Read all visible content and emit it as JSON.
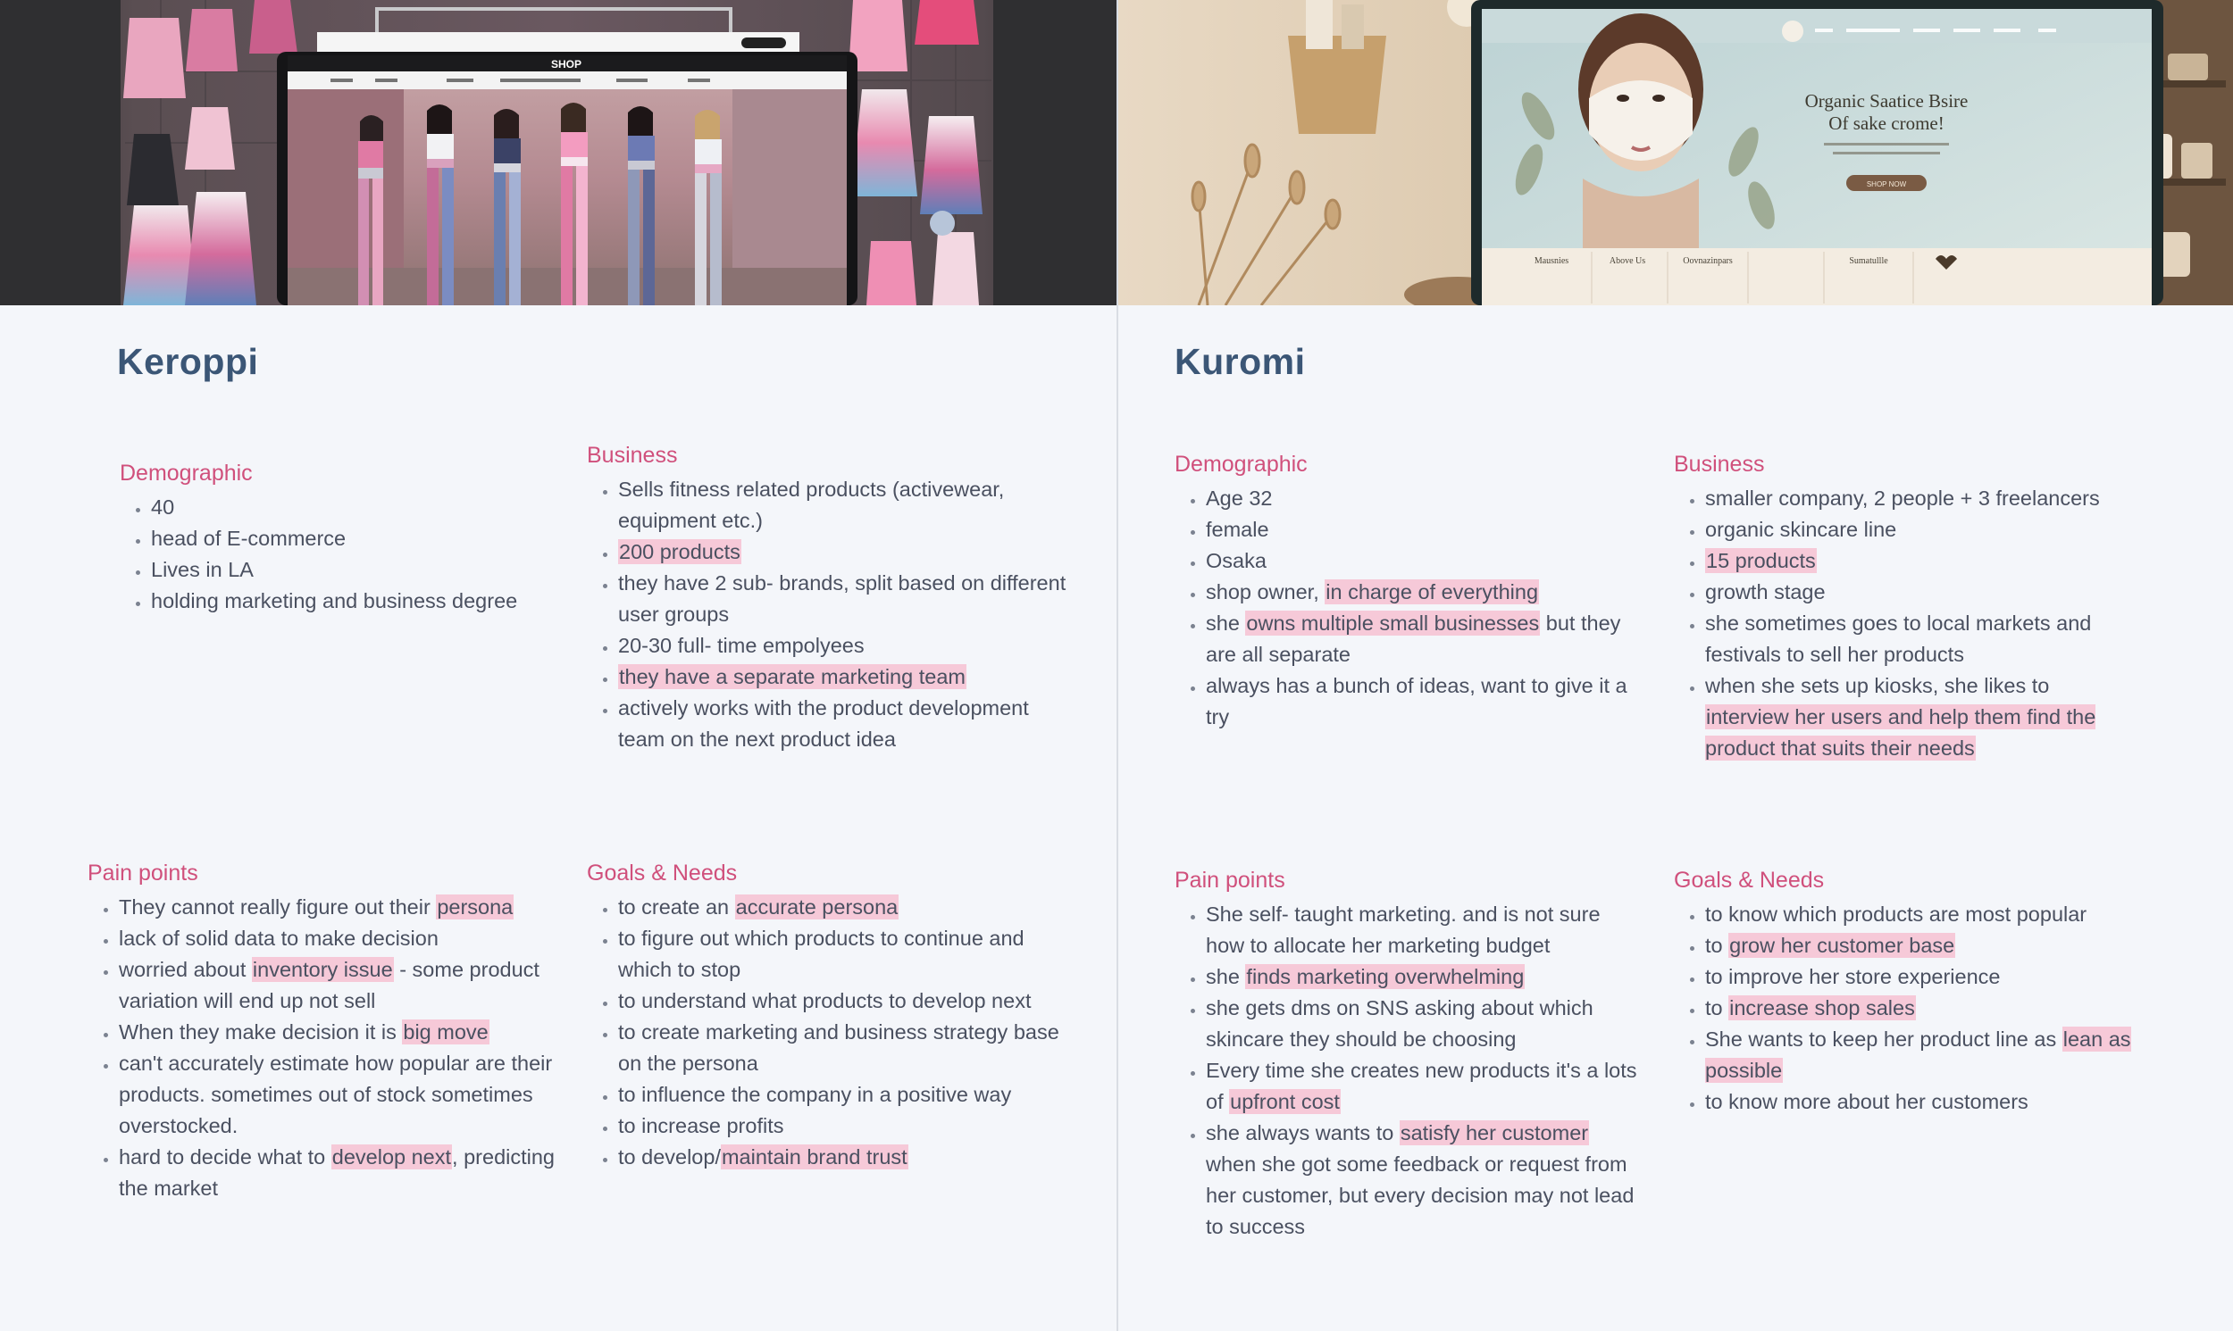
{
  "personas": [
    {
      "name": "Keroppi",
      "demographic": {
        "title": "Demographic",
        "items": [
          [
            {
              "t": "40"
            }
          ],
          [
            {
              "t": "head of E-commerce"
            }
          ],
          [
            {
              "t": "Lives in LA"
            }
          ],
          [
            {
              "t": "holding marketing and business degree"
            }
          ]
        ]
      },
      "business": {
        "title": "Business",
        "items": [
          [
            {
              "t": "Sells fitness related products (activewear, equipment etc.)"
            }
          ],
          [
            {
              "t": "200 products",
              "h": true
            }
          ],
          [
            {
              "t": "they have 2 sub- brands, split based on different user groups"
            }
          ],
          [
            {
              "t": "20-30 full- time empolyees"
            }
          ],
          [
            {
              "t": "they have a separate marketing team",
              "h": true
            }
          ],
          [
            {
              "t": "actively works with the product development team on the next product idea"
            }
          ]
        ]
      },
      "pain_points": {
        "title": "Pain points",
        "items": [
          [
            {
              "t": "They cannot really figure out their "
            },
            {
              "t": "persona",
              "h": true
            }
          ],
          [
            {
              "t": "lack of solid data to make decision"
            }
          ],
          [
            {
              "t": "worried about "
            },
            {
              "t": "inventory issue",
              "h": true
            },
            {
              "t": " - some product variation will end up not sell"
            }
          ],
          [
            {
              "t": "When they make decision it is "
            },
            {
              "t": "big move",
              "h": true
            }
          ],
          [
            {
              "t": "can't accurately estimate how popular are their products. sometimes out of stock sometimes overstocked."
            }
          ],
          [
            {
              "t": "hard to decide what to "
            },
            {
              "t": "develop next",
              "h": true
            },
            {
              "t": ", predicting the market"
            }
          ]
        ]
      },
      "goals": {
        "title": "Goals & Needs",
        "items": [
          [
            {
              "t": "to create an "
            },
            {
              "t": "accurate persona ",
              "h": true
            }
          ],
          [
            {
              "t": "to figure out which products to continue and which to stop"
            }
          ],
          [
            {
              "t": "to understand what products to develop next"
            }
          ],
          [
            {
              "t": "to create marketing and business strategy base on the persona"
            }
          ],
          [
            {
              "t": "to influence the company in a positive way"
            }
          ],
          [
            {
              "t": "to increase profits"
            }
          ],
          [
            {
              "t": "to develop/"
            },
            {
              "t": "maintain brand trust",
              "h": true
            }
          ]
        ]
      }
    },
    {
      "name": "Kuromi",
      "demographic": {
        "title": "Demographic",
        "items": [
          [
            {
              "t": "Age 32"
            }
          ],
          [
            {
              "t": "female"
            }
          ],
          [
            {
              "t": "Osaka"
            }
          ],
          [
            {
              "t": "shop owner, "
            },
            {
              "t": "in charge of everything",
              "h": true
            }
          ],
          [
            {
              "t": "she "
            },
            {
              "t": "owns multiple small businesses",
              "h": true
            },
            {
              "t": " but they are all separate"
            }
          ],
          [
            {
              "t": "always has a bunch of ideas, want to give it a try"
            }
          ]
        ]
      },
      "business": {
        "title": "Business",
        "items": [
          [
            {
              "t": "smaller company, 2 people + 3 freelancers"
            }
          ],
          [
            {
              "t": "organic skincare line"
            }
          ],
          [
            {
              "t": "15 products",
              "h": true
            }
          ],
          [
            {
              "t": "growth stage"
            }
          ],
          [
            {
              "t": "she sometimes goes to local markets and festivals to sell her products"
            }
          ],
          [
            {
              "t": "when she sets up kiosks, she likes to "
            },
            {
              "t": "interview her users and help them find the product that suits their needs",
              "h": true
            }
          ]
        ]
      },
      "pain_points": {
        "title": "Pain points",
        "items": [
          [
            {
              "t": "She  self- taught marketing. and is not sure how to allocate her marketing budget"
            }
          ],
          [
            {
              "t": "she "
            },
            {
              "t": "finds marketing overwhelming",
              "h": true
            }
          ],
          [
            {
              "t": "she gets dms on SNS asking about which skincare they should be choosing"
            }
          ],
          [
            {
              "t": "Every time she creates new products it's a lots of "
            },
            {
              "t": "upfront cost",
              "h": true
            }
          ],
          [
            {
              "t": "she always wants to "
            },
            {
              "t": "satisfy her customer",
              "h": true
            },
            {
              "t": " when she got some feedback or request from her customer, but every decision may not lead to success"
            }
          ]
        ]
      },
      "goals": {
        "title": "Goals & Needs",
        "items": [
          [
            {
              "t": "to know which products are most popular"
            }
          ],
          [
            {
              "t": "to "
            },
            {
              "t": "grow her customer base",
              "h": true
            }
          ],
          [
            {
              "t": "to improve her store experience"
            }
          ],
          [
            {
              "t": "to "
            },
            {
              "t": "increase shop sales",
              "h": true
            }
          ],
          [
            {
              "t": "She wants to keep her product line as "
            },
            {
              "t": "lean as possible ",
              "h": true
            }
          ],
          [
            {
              "t": "to know more about her customers"
            }
          ]
        ]
      }
    }
  ],
  "hero_left": {
    "shop_label": "SHOP",
    "bg": "#3a3a3c"
  },
  "hero_right": {
    "headline_1": "Organic Saatice Bsire",
    "headline_2": "Of sake crome!",
    "cta": "SHOP NOW",
    "nav": [
      "Mausnies",
      "Above Us",
      "Oovnazinpars",
      "Sumatullle"
    ]
  },
  "colors": {
    "accent": "#d0507c",
    "name": "#3b5676",
    "highlight": "#f6c9d8",
    "text": "#4a5060",
    "background": "#f4f6fa"
  }
}
